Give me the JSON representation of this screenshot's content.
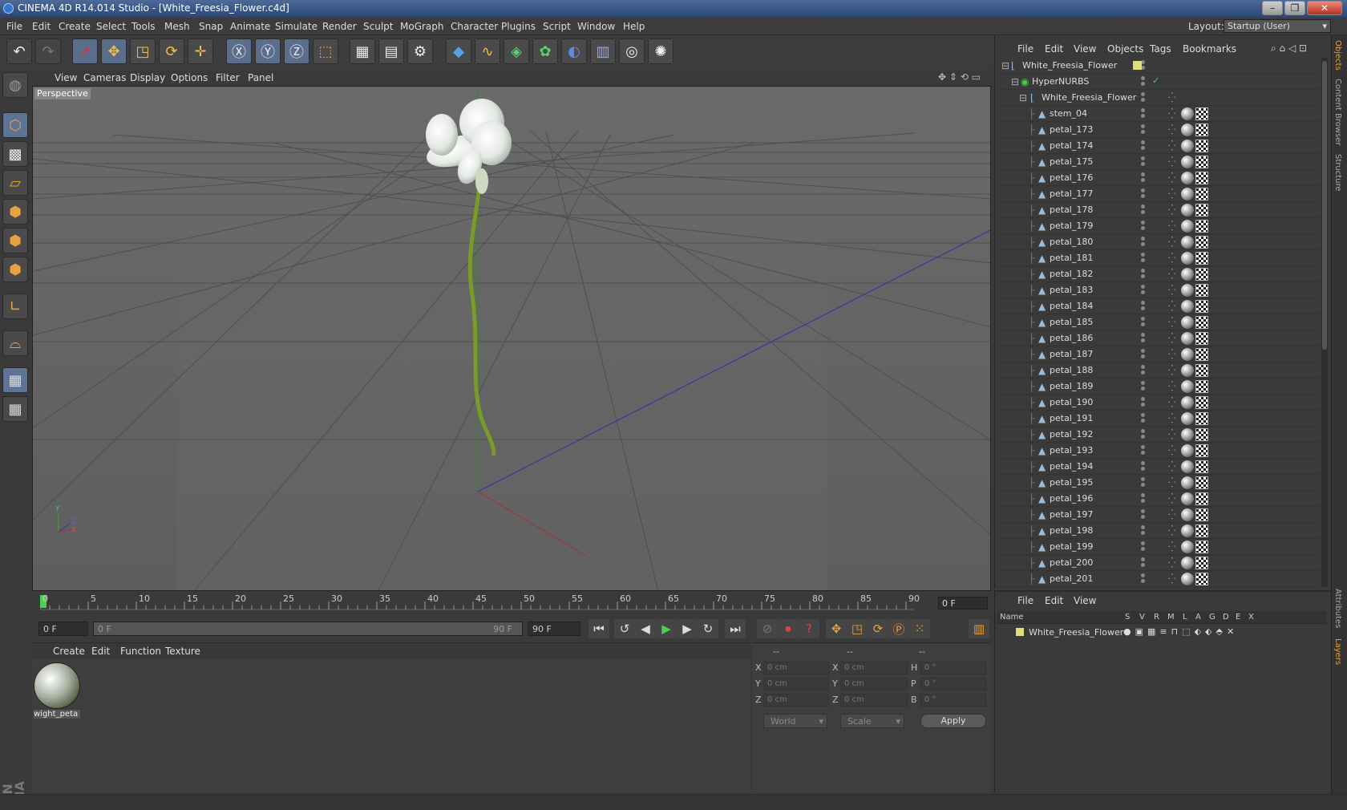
{
  "window": {
    "title": "CINEMA 4D R14.014 Studio - [White_Freesia_Flower.c4d]"
  },
  "menu": [
    "File",
    "Edit",
    "Create",
    "Select",
    "Tools",
    "Mesh",
    "Snap",
    "Animate",
    "Simulate",
    "Render",
    "Sculpt",
    "MoGraph",
    "Character",
    "Plugins",
    "Script",
    "Window",
    "Help"
  ],
  "layout": {
    "label": "Layout:",
    "value": "Startup (User)"
  },
  "viewport": {
    "menu": [
      "View",
      "Cameras",
      "Display",
      "Options",
      "Filter",
      "Panel"
    ],
    "label": "Perspective",
    "axis": {
      "x": "X",
      "y": "Y",
      "z": "Z"
    }
  },
  "timeline": {
    "ticks": [
      "0",
      "5",
      "10",
      "15",
      "20",
      "25",
      "30",
      "35",
      "40",
      "45",
      "50",
      "55",
      "60",
      "65",
      "70",
      "75",
      "80",
      "85",
      "90"
    ],
    "current_frame": "0 F"
  },
  "playback": {
    "start": "0 F",
    "range_start": "0 F",
    "range_end": "90 F",
    "end": "90 F"
  },
  "material_manager": {
    "menu": [
      "Create",
      "Edit",
      "Function",
      "Texture"
    ],
    "materials": [
      {
        "name": "wight_peta"
      }
    ]
  },
  "coordinates": {
    "headers": [
      "--",
      "--",
      "--"
    ],
    "rows": [
      {
        "a": "X",
        "av": "0 cm",
        "b": "X",
        "bv": "0 cm",
        "c": "H",
        "cv": "0 °"
      },
      {
        "a": "Y",
        "av": "0 cm",
        "b": "Y",
        "bv": "0 cm",
        "c": "P",
        "cv": "0 °"
      },
      {
        "a": "Z",
        "av": "0 cm",
        "b": "Z",
        "bv": "0 cm",
        "c": "B",
        "cv": "0 °"
      }
    ],
    "mode": "World",
    "size": "Scale",
    "apply": "Apply"
  },
  "object_manager": {
    "menu": [
      "File",
      "Edit",
      "View",
      "Objects",
      "Tags",
      "Bookmarks"
    ],
    "root": "White_Freesia_Flower",
    "nurbs": "HyperNURBS",
    "group": "White_Freesia_Flower",
    "objects": [
      "stem_04",
      "petal_173",
      "petal_174",
      "petal_175",
      "petal_176",
      "petal_177",
      "petal_178",
      "petal_179",
      "petal_180",
      "petal_181",
      "petal_182",
      "petal_183",
      "petal_184",
      "petal_185",
      "petal_186",
      "petal_187",
      "petal_188",
      "petal_189",
      "petal_190",
      "petal_191",
      "petal_192",
      "petal_193",
      "petal_194",
      "petal_195",
      "petal_196",
      "petal_197",
      "petal_198",
      "petal_199",
      "petal_200",
      "petal_201"
    ]
  },
  "layer_manager": {
    "menu": [
      "File",
      "Edit",
      "View"
    ],
    "columns": [
      "Name",
      "S",
      "V",
      "R",
      "M",
      "L",
      "A",
      "G",
      "D",
      "E",
      "X"
    ],
    "layers": [
      {
        "name": "White_Freesia_Flower",
        "color": "#dede7a"
      }
    ]
  },
  "side_tabs": [
    "Objects",
    "Content Browser",
    "Structure",
    "Attributes",
    "Layers"
  ],
  "colors": {
    "accent": "#e8a040",
    "layer": "#dede7a",
    "selection": "#5d7494"
  }
}
